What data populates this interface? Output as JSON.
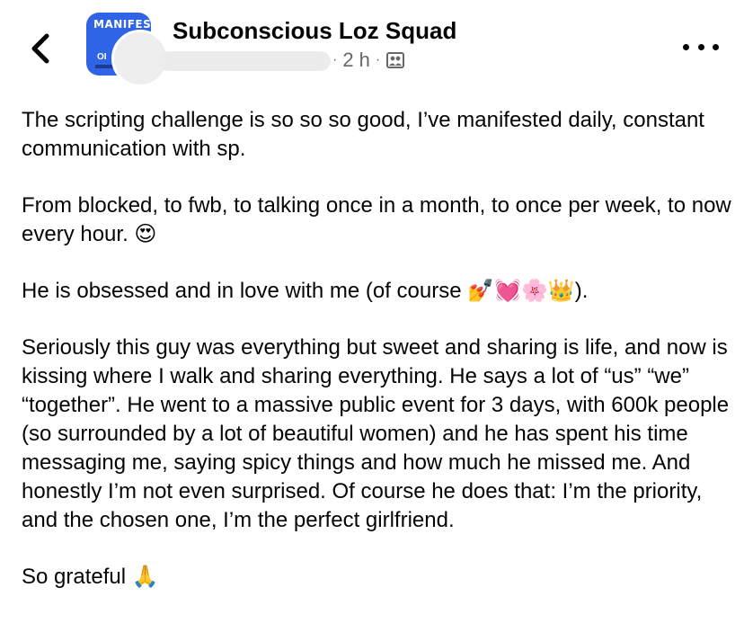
{
  "header": {
    "group_name": "Subconscious Loz Squad",
    "group_avatar_text": "MANIFEST",
    "time": "2 h",
    "separator": "·",
    "audience_icon": "group-audience-icon",
    "back_icon": "chevron-left-icon",
    "more_icon": "more-horizontal-icon"
  },
  "post": {
    "paragraphs": [
      "The scripting challenge is so so so good, I’ve manifested daily, constant communication with sp.",
      "From blocked, to fwb, to talking once in a month, to once per week, to now every hour. 😍",
      "He is obsessed and in love with me (of course 💅💓🌸👑).",
      "Seriously this guy was everything but sweet and sharing is life, and now is kissing where I walk and sharing everything. He says a lot of “us” “we” “together”. He went to a massive public event for 3 days, with 600k people (so surrounded by a lot of beautiful women) and he has spent his time messaging me, saying spicy things and how much he missed me. And honestly I’m not even surprised. Of course he does that: I’m the priority, and the chosen one, I’m the perfect girlfriend.",
      "So grateful 🙏"
    ]
  },
  "colors": {
    "text": "#050505",
    "meta": "#65676b",
    "group_avatar_bg": "#2f64e6"
  }
}
